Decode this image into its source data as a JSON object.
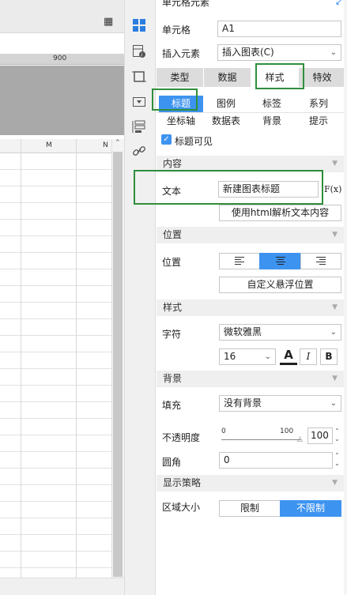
{
  "panel": {
    "title": "单元格元素",
    "cell_label": "单元格",
    "cell_value": "A1",
    "insert_label": "插入元素",
    "insert_value": "插入图表(C)",
    "tabs": [
      "类型",
      "数据",
      "样式",
      "特效"
    ],
    "active_tab": "样式",
    "subtabs": [
      "标题",
      "图例",
      "标签",
      "系列",
      "坐标轴",
      "数据表",
      "背景",
      "提示"
    ],
    "active_subtab": "标题",
    "title_visible_label": "标题可见",
    "content_section": "内容",
    "text_label": "文本",
    "text_value": "新建图表标题",
    "formula_btn": "F(x)",
    "parse_html_btn": "使用html解析文本内容",
    "position_section": "位置",
    "position_label": "位置",
    "custom_position_btn": "自定义悬浮位置",
    "style_section": "样式",
    "font_label": "字符",
    "font_value": "微软雅黑",
    "font_size": "16",
    "bold_btn": "B",
    "italic_btn": "I",
    "color_btn": "A",
    "bg_section": "背景",
    "fill_label": "填充",
    "fill_value": "没有背景",
    "opacity_label": "不透明度",
    "opacity_min": "0",
    "opacity_max": "100",
    "opacity_value": "100",
    "radius_label": "圆角",
    "radius_value": "0",
    "display_section": "显示策略",
    "area_label": "区域大小",
    "limit_btn": "限制",
    "nolimit_btn": "不限制"
  },
  "sheet": {
    "ruler_mark": "900",
    "col_m": "M",
    "col_n": "N"
  },
  "colors": {
    "accent": "#3d93f0",
    "highlight": "#2f8f3b"
  },
  "controls": {
    "title_visible": true,
    "opacity_percent": 100,
    "position_align": "center",
    "display_policy": "不限制"
  }
}
